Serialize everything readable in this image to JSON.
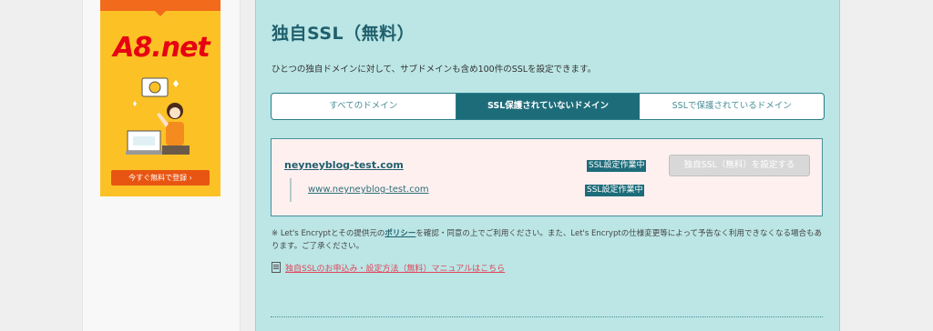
{
  "ad": {
    "logo": "A8.net",
    "cta": "今すぐ無料で登録 ›"
  },
  "section": {
    "title": "独自SSL（無料）",
    "description": "ひとつの独自ドメインに対して、サブドメインも含め100件のSSLを設定できます。"
  },
  "tabs": [
    {
      "label": "すべてのドメイン",
      "active": false
    },
    {
      "label": "SSL保護されていないドメイン",
      "active": true
    },
    {
      "label": "SSLで保護されているドメイン",
      "active": false
    }
  ],
  "domains": {
    "main": {
      "name": "neyneyblog-test.com",
      "status": "SSL設定作業中"
    },
    "sub": {
      "name": "www.neyneyblog-test.com",
      "status": "SSL設定作業中"
    }
  },
  "ssl_button_label": "独自SSL（無料）を設定する",
  "notice": {
    "prefix": "※ Let's Encryptとその提供元の",
    "policy_link": "ポリシー",
    "suffix": "を確認・同意の上でご利用ください。また、Let's Encryptの仕様変更等によって予告なく利用できなくなる場合もあります。ご了承ください。"
  },
  "manual_link": "独自SSLのお申込み・設定方法（無料）マニュアルはこちら",
  "colors": {
    "accent": "#1d6c7a",
    "panel_bg": "#bbe6e5",
    "ad_bg": "#fcc125",
    "logo_red": "#e60012",
    "link_red": "#e0445a"
  }
}
